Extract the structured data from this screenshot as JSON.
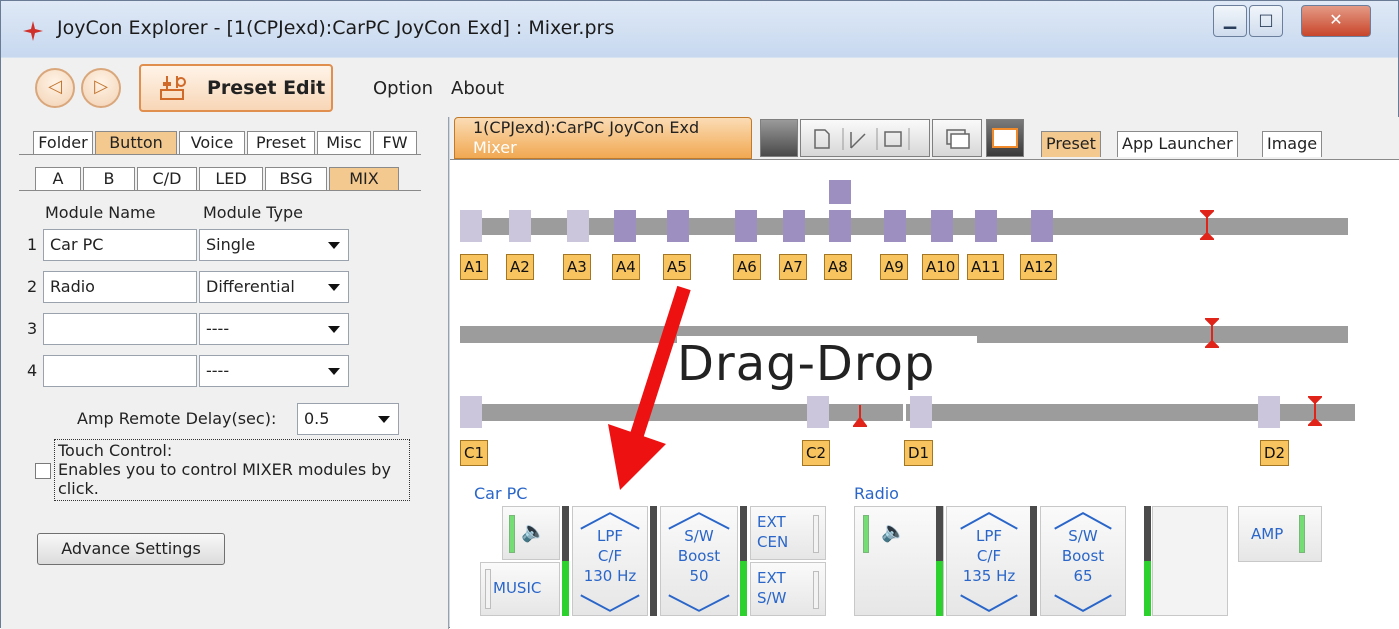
{
  "window": {
    "title": "JoyCon Explorer - [1(CPJexd):CarPC JoyCon Exd] : Mixer.prs"
  },
  "menu": {
    "preset_edit": "Preset Edit",
    "option": "Option",
    "about": "About"
  },
  "left": {
    "tabs": [
      "Folder",
      "Button",
      "Voice",
      "Preset",
      "Misc",
      "FW"
    ],
    "subtabs": [
      "A",
      "B",
      "C/D",
      "LED",
      "BSG",
      "MIX"
    ],
    "col_module_name": "Module Name",
    "col_module_type": "Module Type",
    "modules": [
      {
        "num": "1",
        "name": "Car PC",
        "type": "Single"
      },
      {
        "num": "2",
        "name": "Radio",
        "type": "Differential"
      },
      {
        "num": "3",
        "name": "",
        "type": "----"
      },
      {
        "num": "4",
        "name": "",
        "type": "----"
      }
    ],
    "amp_delay_label": "Amp Remote Delay(sec):",
    "amp_delay_value": "0.5",
    "touch_line1": "Touch Control:",
    "touch_line2": "Enables you to control MIXER modules by",
    "touch_line3": "click.",
    "advance_settings": "Advance Settings"
  },
  "right": {
    "mixer_tab_line1": "1(CPJexd):CarPC JoyCon Exd",
    "mixer_tab_line2": "Mixer",
    "tabs": [
      "Preset",
      "App Launcher",
      "Image"
    ],
    "channel_labels_a": [
      "A1",
      "A2",
      "A3",
      "A4",
      "A5",
      "A6",
      "A7",
      "A8",
      "A9",
      "A10",
      "A11",
      "A12"
    ],
    "channel_labels_cd": [
      "C1",
      "C2",
      "D1",
      "D2"
    ],
    "drag_drop": "Drag-Drop",
    "car_pc": {
      "title": "Car PC",
      "music": "MUSIC",
      "lpf": "LPF",
      "cf": "C/F",
      "cf_value": "130 Hz",
      "sw": "S/W",
      "boost": "Boost",
      "boost_value": "50",
      "ext1": "EXT",
      "cen": "CEN",
      "ext2": "EXT",
      "sw2": "S/W"
    },
    "radio": {
      "title": "Radio",
      "lpf": "LPF",
      "cf": "C/F",
      "cf_value": "135 Hz",
      "sw": "S/W",
      "boost": "Boost",
      "boost_value": "65"
    },
    "amp": "AMP"
  },
  "colors": {
    "accent_orange": "#f1a851",
    "channel_purple": "#9d8fc0",
    "mixer_text_blue": "#2a66c9",
    "meter_green": "#2dd12d",
    "arrow_red": "#ee1111"
  }
}
